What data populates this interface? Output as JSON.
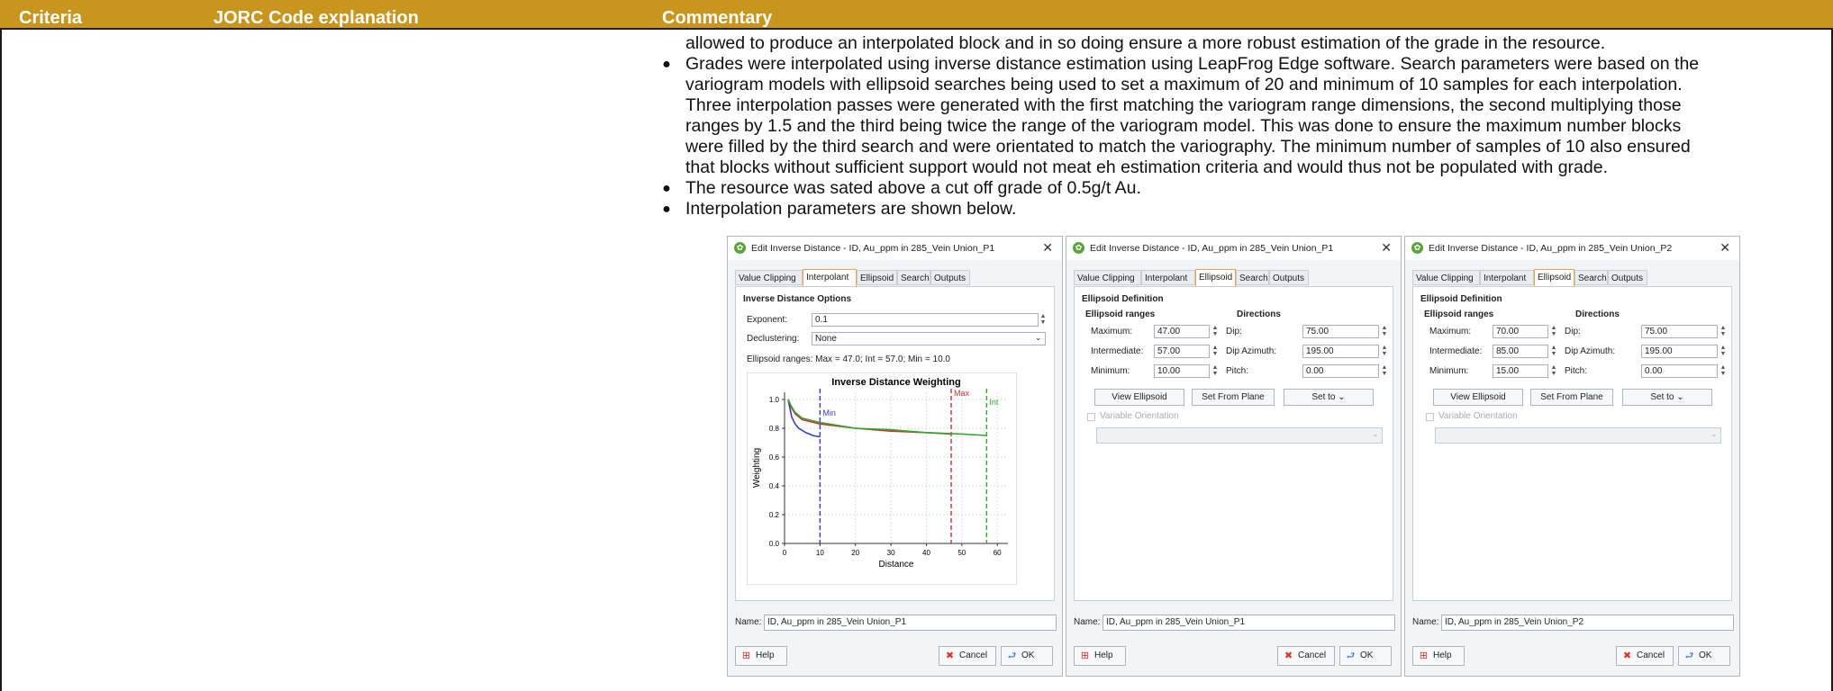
{
  "table": {
    "headers": [
      "Criteria",
      "JORC Code explanation",
      "Commentary"
    ]
  },
  "commentary": {
    "intro": "allowed to produce an interpolated block and in so doing ensure a more robust estimation of the grade in the resource.",
    "bullets": [
      {
        "lines": [
          "Grades were interpolated using inverse distance estimation using LeapFrog Edge software. Search parameters were based on the",
          "variogram models with ellipsoid searches being used to set a maximum of 20 and minimum of 10 samples for each interpolation.",
          "Three interpolation passes were generated with the first matching the variogram range dimensions, the second multiplying those",
          "ranges by 1.5 and the third being twice the range of the variogram model. This was done to ensure the maximum number blocks",
          "were filled by the third search and were orientated to match the variography. The minimum number of samples of 10 also ensured",
          "that blocks without sufficient support would not meat eh estimation criteria and would thus not be populated with grade."
        ]
      },
      {
        "lines": [
          "The resource was sated above a cut off grade of 0.5g/t Au."
        ]
      },
      {
        "lines": [
          "Interpolation parameters are shown below."
        ]
      }
    ]
  },
  "dialogs": [
    {
      "title": "Edit Inverse Distance - ID, Au_ppm in 285_Vein Union_P1",
      "tabs": [
        "Value Clipping",
        "Interpolant",
        "Ellipsoid",
        "Search",
        "Outputs"
      ],
      "active_tab": "Interpolant",
      "section_title": "Inverse Distance Options",
      "exponent_label": "Exponent:",
      "exponent_value": "0.1",
      "declustering_label": "Declustering:",
      "declustering_value": "None",
      "ranges_text": "Ellipsoid ranges: Max = 47.0; Int = 57.0; Min = 10.0",
      "name_label": "Name:",
      "name_value": "ID, Au_ppm in 285_Vein Union_P1",
      "help_label": "Help",
      "cancel_label": "Cancel",
      "ok_label": "OK"
    },
    {
      "title": "Edit Inverse Distance - ID, Au_ppm in 285_Vein Union_P1",
      "tabs": [
        "Value Clipping",
        "Interpolant",
        "Ellipsoid",
        "Search",
        "Outputs"
      ],
      "active_tab": "Ellipsoid",
      "section_title": "Ellipsoid Definition",
      "ranges_header": "Ellipsoid ranges",
      "directions_header": "Directions",
      "maximum_label": "Maximum:",
      "maximum_value": "47.00",
      "intermediate_label": "Intermediate:",
      "intermediate_value": "57.00",
      "minimum_label": "Minimum:",
      "minimum_value": "10.00",
      "dip_label": "Dip:",
      "dip_value": "75.00",
      "dip_azimuth_label": "Dip Azimuth:",
      "dip_azimuth_value": "195.00",
      "pitch_label": "Pitch:",
      "pitch_value": "0.00",
      "view_ellipsoid_label": "View Ellipsoid",
      "set_from_plane_label": "Set From Plane",
      "set_to_label": "Set to",
      "variable_orientation_label": "Variable Orientation",
      "name_label": "Name:",
      "name_value": "ID, Au_ppm in 285_Vein Union_P1",
      "help_label": "Help",
      "cancel_label": "Cancel",
      "ok_label": "OK"
    },
    {
      "title": "Edit Inverse Distance - ID, Au_ppm in 285_Vein Union_P2",
      "tabs": [
        "Value Clipping",
        "Interpolant",
        "Ellipsoid",
        "Search",
        "Outputs"
      ],
      "active_tab": "Ellipsoid",
      "section_title": "Ellipsoid Definition",
      "ranges_header": "Ellipsoid ranges",
      "directions_header": "Directions",
      "maximum_label": "Maximum:",
      "maximum_value": "70.00",
      "intermediate_label": "Intermediate:",
      "intermediate_value": "85.00",
      "minimum_label": "Minimum:",
      "minimum_value": "15.00",
      "dip_label": "Dip:",
      "dip_value": "75.00",
      "dip_azimuth_label": "Dip Azimuth:",
      "dip_azimuth_value": "195.00",
      "pitch_label": "Pitch:",
      "pitch_value": "0.00",
      "view_ellipsoid_label": "View Ellipsoid",
      "set_from_plane_label": "Set From Plane",
      "set_to_label": "Set to",
      "variable_orientation_label": "Variable Orientation",
      "name_label": "Name:",
      "name_value": "ID, Au_ppm in 285_Vein Union_P2",
      "help_label": "Help",
      "cancel_label": "Cancel",
      "ok_label": "OK"
    }
  ],
  "chart_data": {
    "type": "line",
    "title": "Inverse Distance Weighting",
    "xlabel": "Distance",
    "ylabel": "Weighting",
    "xlim": [
      0,
      63
    ],
    "ylim": [
      0,
      1.05
    ],
    "xticks": [
      "0",
      "10",
      "20",
      "30",
      "40",
      "50",
      "60"
    ],
    "yticks": [
      "0.0",
      "0.2",
      "0.4",
      "0.6",
      "0.8",
      "1.0"
    ],
    "grid": true,
    "series": [
      {
        "name": "Min",
        "color": "#3a3ac8",
        "cutoff": 10,
        "x": [
          1,
          2,
          3,
          4,
          6,
          8,
          10
        ],
        "y": [
          1.0,
          0.88,
          0.83,
          0.8,
          0.77,
          0.75,
          0.74
        ]
      },
      {
        "name": "Max",
        "color": "#c83232",
        "cutoff": 47,
        "x": [
          1,
          2,
          3,
          5,
          10,
          20,
          30,
          40,
          47
        ],
        "y": [
          1.0,
          0.94,
          0.9,
          0.86,
          0.83,
          0.8,
          0.78,
          0.77,
          0.76
        ]
      },
      {
        "name": "Int",
        "color": "#32a832",
        "cutoff": 57,
        "x": [
          1,
          2,
          3,
          5,
          10,
          20,
          30,
          40,
          50,
          57
        ],
        "y": [
          1.0,
          0.95,
          0.91,
          0.87,
          0.84,
          0.8,
          0.79,
          0.77,
          0.76,
          0.75
        ]
      }
    ]
  },
  "colors": {
    "header_bg": "#c8961e",
    "active_tab_border": "#e6a34a"
  },
  "icons": {
    "app": "leapfrog-app-icon",
    "close": "close-icon",
    "help": "help-icon",
    "cancel": "cancel-icon",
    "ok": "ok-icon"
  }
}
